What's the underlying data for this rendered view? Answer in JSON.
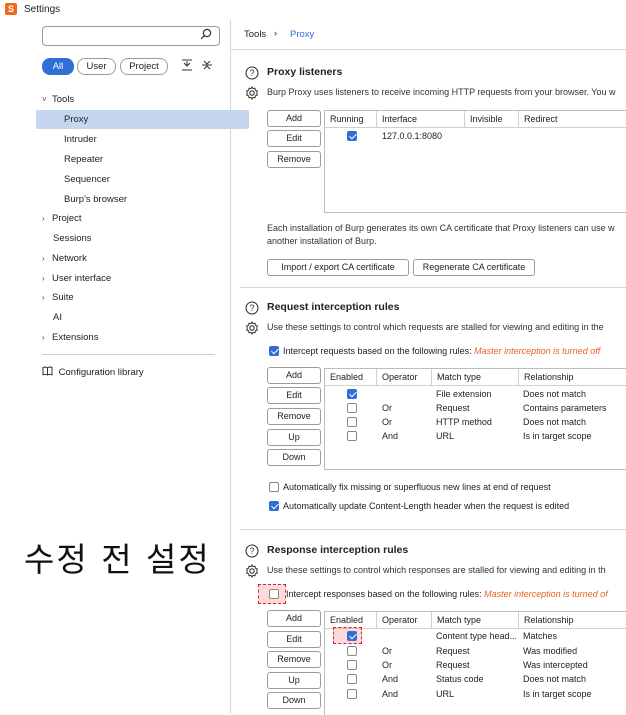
{
  "window": {
    "title": "Settings",
    "app_icon_glyph": "S"
  },
  "sidebar": {
    "search_placeholder": "",
    "filters": {
      "all": "All",
      "user": "User",
      "project": "Project"
    },
    "items": [
      {
        "label": "Tools",
        "chev": "˅"
      },
      {
        "label": "Proxy"
      },
      {
        "label": "Intruder"
      },
      {
        "label": "Repeater"
      },
      {
        "label": "Sequencer"
      },
      {
        "label": "Burp's browser"
      },
      {
        "label": "Project",
        "chev": "›"
      },
      {
        "label": "Sessions"
      },
      {
        "label": "Network",
        "chev": "›"
      },
      {
        "label": "User interface",
        "chev": "›"
      },
      {
        "label": "Suite",
        "chev": "›"
      },
      {
        "label": "AI"
      },
      {
        "label": "Extensions",
        "chev": "›"
      }
    ],
    "config_library": "Configuration library"
  },
  "breadcrumb": {
    "tools": "Tools",
    "sep": "›",
    "proxy": "Proxy"
  },
  "proxy_listeners": {
    "title": "Proxy listeners",
    "desc": "Burp Proxy uses listeners to receive incoming HTTP requests from your browser. You w",
    "buttons": {
      "add": "Add",
      "edit": "Edit",
      "remove": "Remove"
    },
    "columns": [
      "Running",
      "Interface",
      "Invisible",
      "Redirect"
    ],
    "rows": [
      {
        "running": true,
        "interface": "127.0.0.1:8080",
        "invisible": "",
        "redirect": ""
      }
    ],
    "ca_text_1": "Each installation of Burp generates its own CA certificate that Proxy listeners can use w",
    "ca_text_2": "another installation of Burp.",
    "import_btn": "Import / export CA certificate",
    "regen_btn": "Regenerate CA certificate"
  },
  "request_rules": {
    "title": "Request interception rules",
    "desc": "Use these settings to control which requests are stalled for viewing and editing in the",
    "intercept_label": "Intercept requests based on the following rules:",
    "intercept_checked": true,
    "warning": "Master interception is turned off",
    "buttons": {
      "add": "Add",
      "edit": "Edit",
      "remove": "Remove",
      "up": "Up",
      "down": "Down"
    },
    "columns": [
      "Enabled",
      "Operator",
      "Match type",
      "Relationship"
    ],
    "rows": [
      {
        "enabled": true,
        "operator": "",
        "match": "File extension",
        "rel": "Does not match"
      },
      {
        "enabled": false,
        "operator": "Or",
        "match": "Request",
        "rel": "Contains parameters"
      },
      {
        "enabled": false,
        "operator": "Or",
        "match": "HTTP method",
        "rel": "Does not match"
      },
      {
        "enabled": false,
        "operator": "And",
        "match": "URL",
        "rel": "Is in target scope"
      }
    ],
    "auto_fix_label": "Automatically fix missing or superfluous new lines at end of request",
    "auto_fix_checked": false,
    "auto_update_label": "Automatically update Content-Length header when the request is edited",
    "auto_update_checked": true
  },
  "response_rules": {
    "title": "Response interception rules",
    "desc": "Use these settings to control which responses are stalled for viewing and editing in th",
    "intercept_label": "Intercept responses based on the following rules:",
    "intercept_checked": false,
    "warning": "Master interception is turned of",
    "buttons": {
      "add": "Add",
      "edit": "Edit",
      "remove": "Remove",
      "up": "Up",
      "down": "Down"
    },
    "columns": [
      "Enabled",
      "Operator",
      "Match type",
      "Relationship"
    ],
    "rows": [
      {
        "enabled": true,
        "operator": "",
        "match": "Content type head...",
        "rel": "Matches"
      },
      {
        "enabled": false,
        "operator": "Or",
        "match": "Request",
        "rel": "Was modified"
      },
      {
        "enabled": false,
        "operator": "Or",
        "match": "Request",
        "rel": "Was intercepted"
      },
      {
        "enabled": false,
        "operator": "And",
        "match": "Status code",
        "rel": "Does not match"
      },
      {
        "enabled": false,
        "operator": "And",
        "match": "URL",
        "rel": "Is in target scope"
      }
    ]
  },
  "annotation": "수정 전 설정"
}
